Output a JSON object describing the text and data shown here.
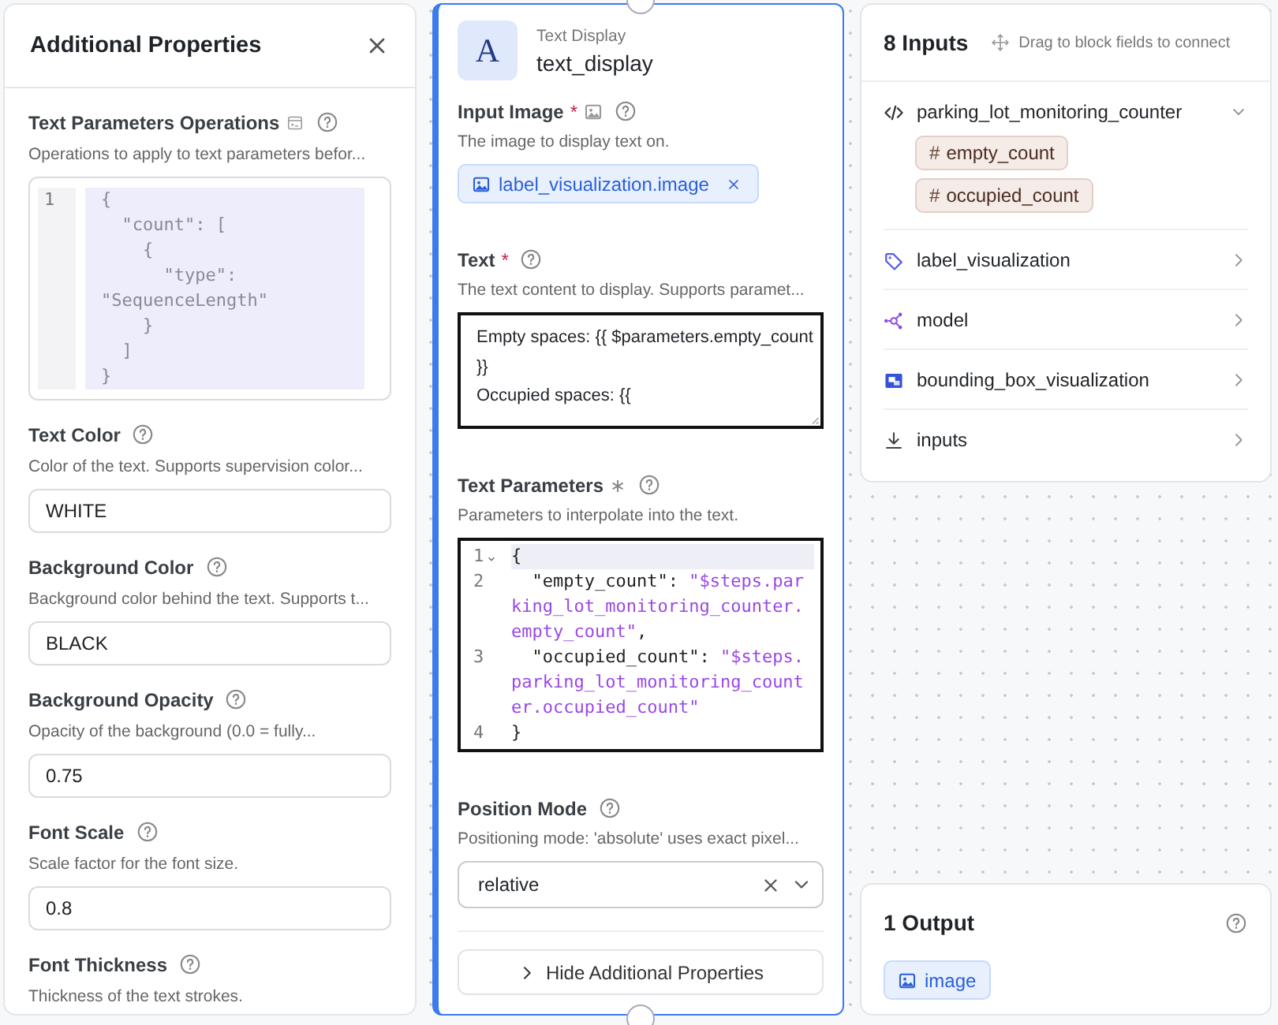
{
  "additional_properties": {
    "title": "Additional Properties",
    "fields": [
      {
        "kind": "code",
        "label": "Text Parameters Operations",
        "type_icon": true,
        "description": "Operations to apply to text parameters befor...",
        "readonly": true,
        "lines": [
          {
            "number": "1",
            "text": "{"
          },
          {
            "text": "  \"count\": ["
          },
          {
            "text": "    {"
          },
          {
            "text": "      \"type\":"
          },
          {
            "text": "\"SequenceLength\""
          },
          {
            "text": "    }"
          },
          {
            "text": "  ]"
          },
          {
            "text": "}"
          }
        ]
      },
      {
        "kind": "input",
        "label": "Text Color",
        "description": "Color of the text. Supports supervision color...",
        "value": "WHITE"
      },
      {
        "kind": "input",
        "label": "Background Color",
        "description": "Background color behind the text. Supports t...",
        "value": "BLACK"
      },
      {
        "kind": "input",
        "label": "Background Opacity",
        "description": "Opacity of the background (0.0 = fully...",
        "value": "0.75"
      },
      {
        "kind": "input",
        "label": "Font Scale",
        "description": "Scale factor for the font size.",
        "value": "0.8"
      },
      {
        "kind": "input",
        "label": "Font Thickness",
        "description": "Thickness of the text strokes."
      }
    ]
  },
  "block": {
    "type_label": "Text Display",
    "name": "text_display",
    "icon_letter": "A",
    "fields": [
      {
        "kind": "chips",
        "label": "Input Image",
        "marker": {
          "kind": "required",
          "text": "*"
        },
        "type_icon": true,
        "description": "The image to display text on.",
        "chips": [
          {
            "label": "label_visualization.image",
            "removable": true
          }
        ]
      },
      {
        "kind": "textarea",
        "label": "Text",
        "marker": {
          "kind": "required",
          "text": "*"
        },
        "description": "The text content to display. Supports paramet...",
        "focused": true,
        "value": "Empty spaces: {{ $parameters.empty_count }}\nOccupied spaces: {{"
      },
      {
        "kind": "code",
        "label": "Text Parameters",
        "marker": {
          "kind": "dynamic",
          "text": "∗"
        },
        "description": "Parameters to interpolate into the text.",
        "focused": true,
        "lines": [
          {
            "number": "1",
            "active": true,
            "foldable": true,
            "tokens": [
              {
                "kind": "plain",
                "text": "{"
              }
            ]
          },
          {
            "number": "2",
            "tokens": [
              {
                "kind": "plain",
                "text": "  \"empty_count\": "
              },
              {
                "kind": "string",
                "text": "\"$steps.parking_lot_monitoring_counter.empty_count\""
              },
              {
                "kind": "plain",
                "text": ","
              }
            ]
          },
          {
            "number": "3",
            "tokens": [
              {
                "kind": "plain",
                "text": "  \"occupied_count\": "
              },
              {
                "kind": "string",
                "text": "\"$steps.parking_lot_monitoring_counter.occupied_count\""
              }
            ]
          },
          {
            "number": "4",
            "tokens": [
              {
                "kind": "plain",
                "text": "}"
              }
            ]
          }
        ]
      },
      {
        "kind": "select",
        "label": "Position Mode",
        "description": "Positioning mode: 'absolute' uses exact pixel...",
        "value": "relative",
        "clearable": true
      }
    ],
    "toggle_button": "Hide Additional Properties"
  },
  "inputs_panel": {
    "title": "8 Inputs",
    "hint": "Drag to block fields to connect",
    "groups": [
      {
        "kind": "code",
        "name": "parking_lot_monitoring_counter",
        "expanded": true,
        "children": [
          {
            "symbol": "#",
            "label": "empty_count"
          },
          {
            "symbol": "#",
            "label": "occupied_count"
          }
        ]
      },
      {
        "kind": "tag",
        "name": "label_visualization",
        "expanded": false
      },
      {
        "kind": "model",
        "name": "model",
        "expanded": false
      },
      {
        "kind": "bbox",
        "name": "bounding_box_visualization",
        "expanded": false
      },
      {
        "kind": "download",
        "name": "inputs",
        "expanded": false
      }
    ]
  },
  "outputs_panel": {
    "title": "1 Output",
    "outputs": [
      {
        "label": "image"
      }
    ]
  }
}
